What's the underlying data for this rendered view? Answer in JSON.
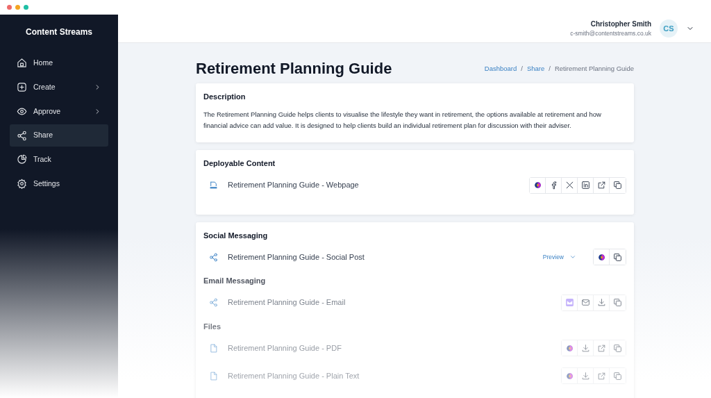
{
  "sidebar": {
    "title": "Content Streams",
    "items": [
      {
        "label": "Home",
        "kind": "home",
        "submenu": false,
        "selected": false
      },
      {
        "label": "Create",
        "kind": "plus",
        "submenu": true,
        "selected": false
      },
      {
        "label": "Approve",
        "kind": "eye",
        "submenu": true,
        "selected": false
      },
      {
        "label": "Share",
        "kind": "share",
        "submenu": false,
        "selected": true
      },
      {
        "label": "Track",
        "kind": "pie",
        "submenu": false,
        "selected": false
      },
      {
        "label": "Settings",
        "kind": "gear",
        "submenu": false,
        "selected": false
      }
    ]
  },
  "user": {
    "name": "Christopher Smith",
    "email": "c-smith@contentstreams.co.uk",
    "initials": "CS"
  },
  "page": {
    "title": "Retirement Planning Guide",
    "breadcrumbs": [
      {
        "label": "Dashboard",
        "link": true
      },
      {
        "separator": "/",
        "label": "Share",
        "link": true
      },
      {
        "separator": "/",
        "label": "Retirement Planning Guide",
        "link": false
      }
    ],
    "description": {
      "heading": "Description",
      "text": "The Retirement Planning Guide helps clients to visualise the lifestyle they want in retirement, the options available at retirement and how financial advice can add value. It is designed to help clients build an individual retirement plan for discussion with their adviser."
    },
    "cards": [
      {
        "sections": [
          {
            "heading": "Deployable Content",
            "items": [
              {
                "label": "Retirement Planning Guide - Webpage",
                "kind": "html",
                "actions": [
                  {
                    "kind": "brand"
                  },
                  {
                    "kind": "facebook"
                  },
                  {
                    "kind": "x"
                  },
                  {
                    "kind": "linkedin"
                  },
                  {
                    "kind": "external"
                  },
                  {
                    "kind": "copy"
                  }
                ]
              }
            ]
          }
        ]
      },
      {
        "sections": [
          {
            "heading": "Social Messaging",
            "items": [
              {
                "label": "Retirement Planning Guide - Social Post",
                "kind": "share",
                "preview": "Preview",
                "actions": [
                  {
                    "kind": "brand"
                  },
                  {
                    "kind": "copy"
                  }
                ]
              }
            ]
          },
          {
            "heading": "Email Messaging",
            "items": [
              {
                "label": "Retirement Planning Guide - Email",
                "kind": "share",
                "actions": [
                  {
                    "kind": "email-image"
                  },
                  {
                    "kind": "mail"
                  },
                  {
                    "kind": "download"
                  },
                  {
                    "kind": "copy"
                  }
                ]
              }
            ]
          },
          {
            "heading": "Files",
            "items": [
              {
                "label": "Retirement Planning Guide - PDF",
                "kind": "file",
                "actions": [
                  {
                    "kind": "brand"
                  },
                  {
                    "kind": "download"
                  },
                  {
                    "kind": "external"
                  },
                  {
                    "kind": "copy"
                  }
                ]
              },
              {
                "label": "Retirement Planning Guide - Plain Text",
                "kind": "file",
                "actions": [
                  {
                    "kind": "brand"
                  },
                  {
                    "kind": "download"
                  },
                  {
                    "kind": "external"
                  },
                  {
                    "kind": "copy"
                  }
                ]
              }
            ]
          }
        ]
      }
    ]
  }
}
